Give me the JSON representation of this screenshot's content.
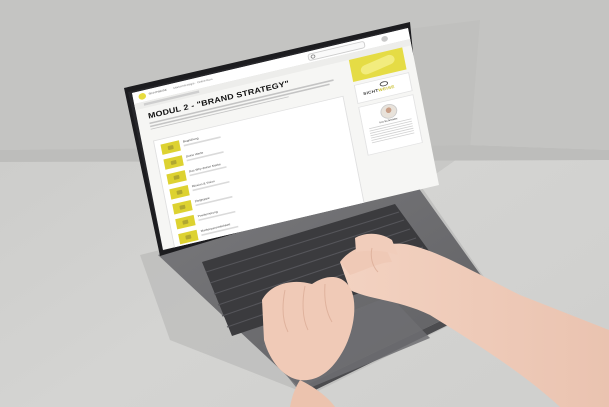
{
  "site": {
    "brand": "SICHTWEISE",
    "nav_text": "Markenstrategie · Online-Kurs"
  },
  "module": {
    "title": "MODUL 2 - \"BRAND STRATEGY\""
  },
  "lessons": [
    {
      "title": "Begrüßung"
    },
    {
      "title": "Deine Werte"
    },
    {
      "title": "Das Why deiner Marke"
    },
    {
      "title": "Mission & Vision"
    },
    {
      "title": "Zielgruppe"
    },
    {
      "title": "Positionierung"
    },
    {
      "title": "Markenpersönlichkeit"
    }
  ],
  "sidebar": {
    "logo_main": "SICHT",
    "logo_accent": "WEISE",
    "profile_name": "Ina Schneider"
  },
  "colors": {
    "accent_yellow": "#e7dc3f",
    "surface": "#d2d2d0"
  }
}
